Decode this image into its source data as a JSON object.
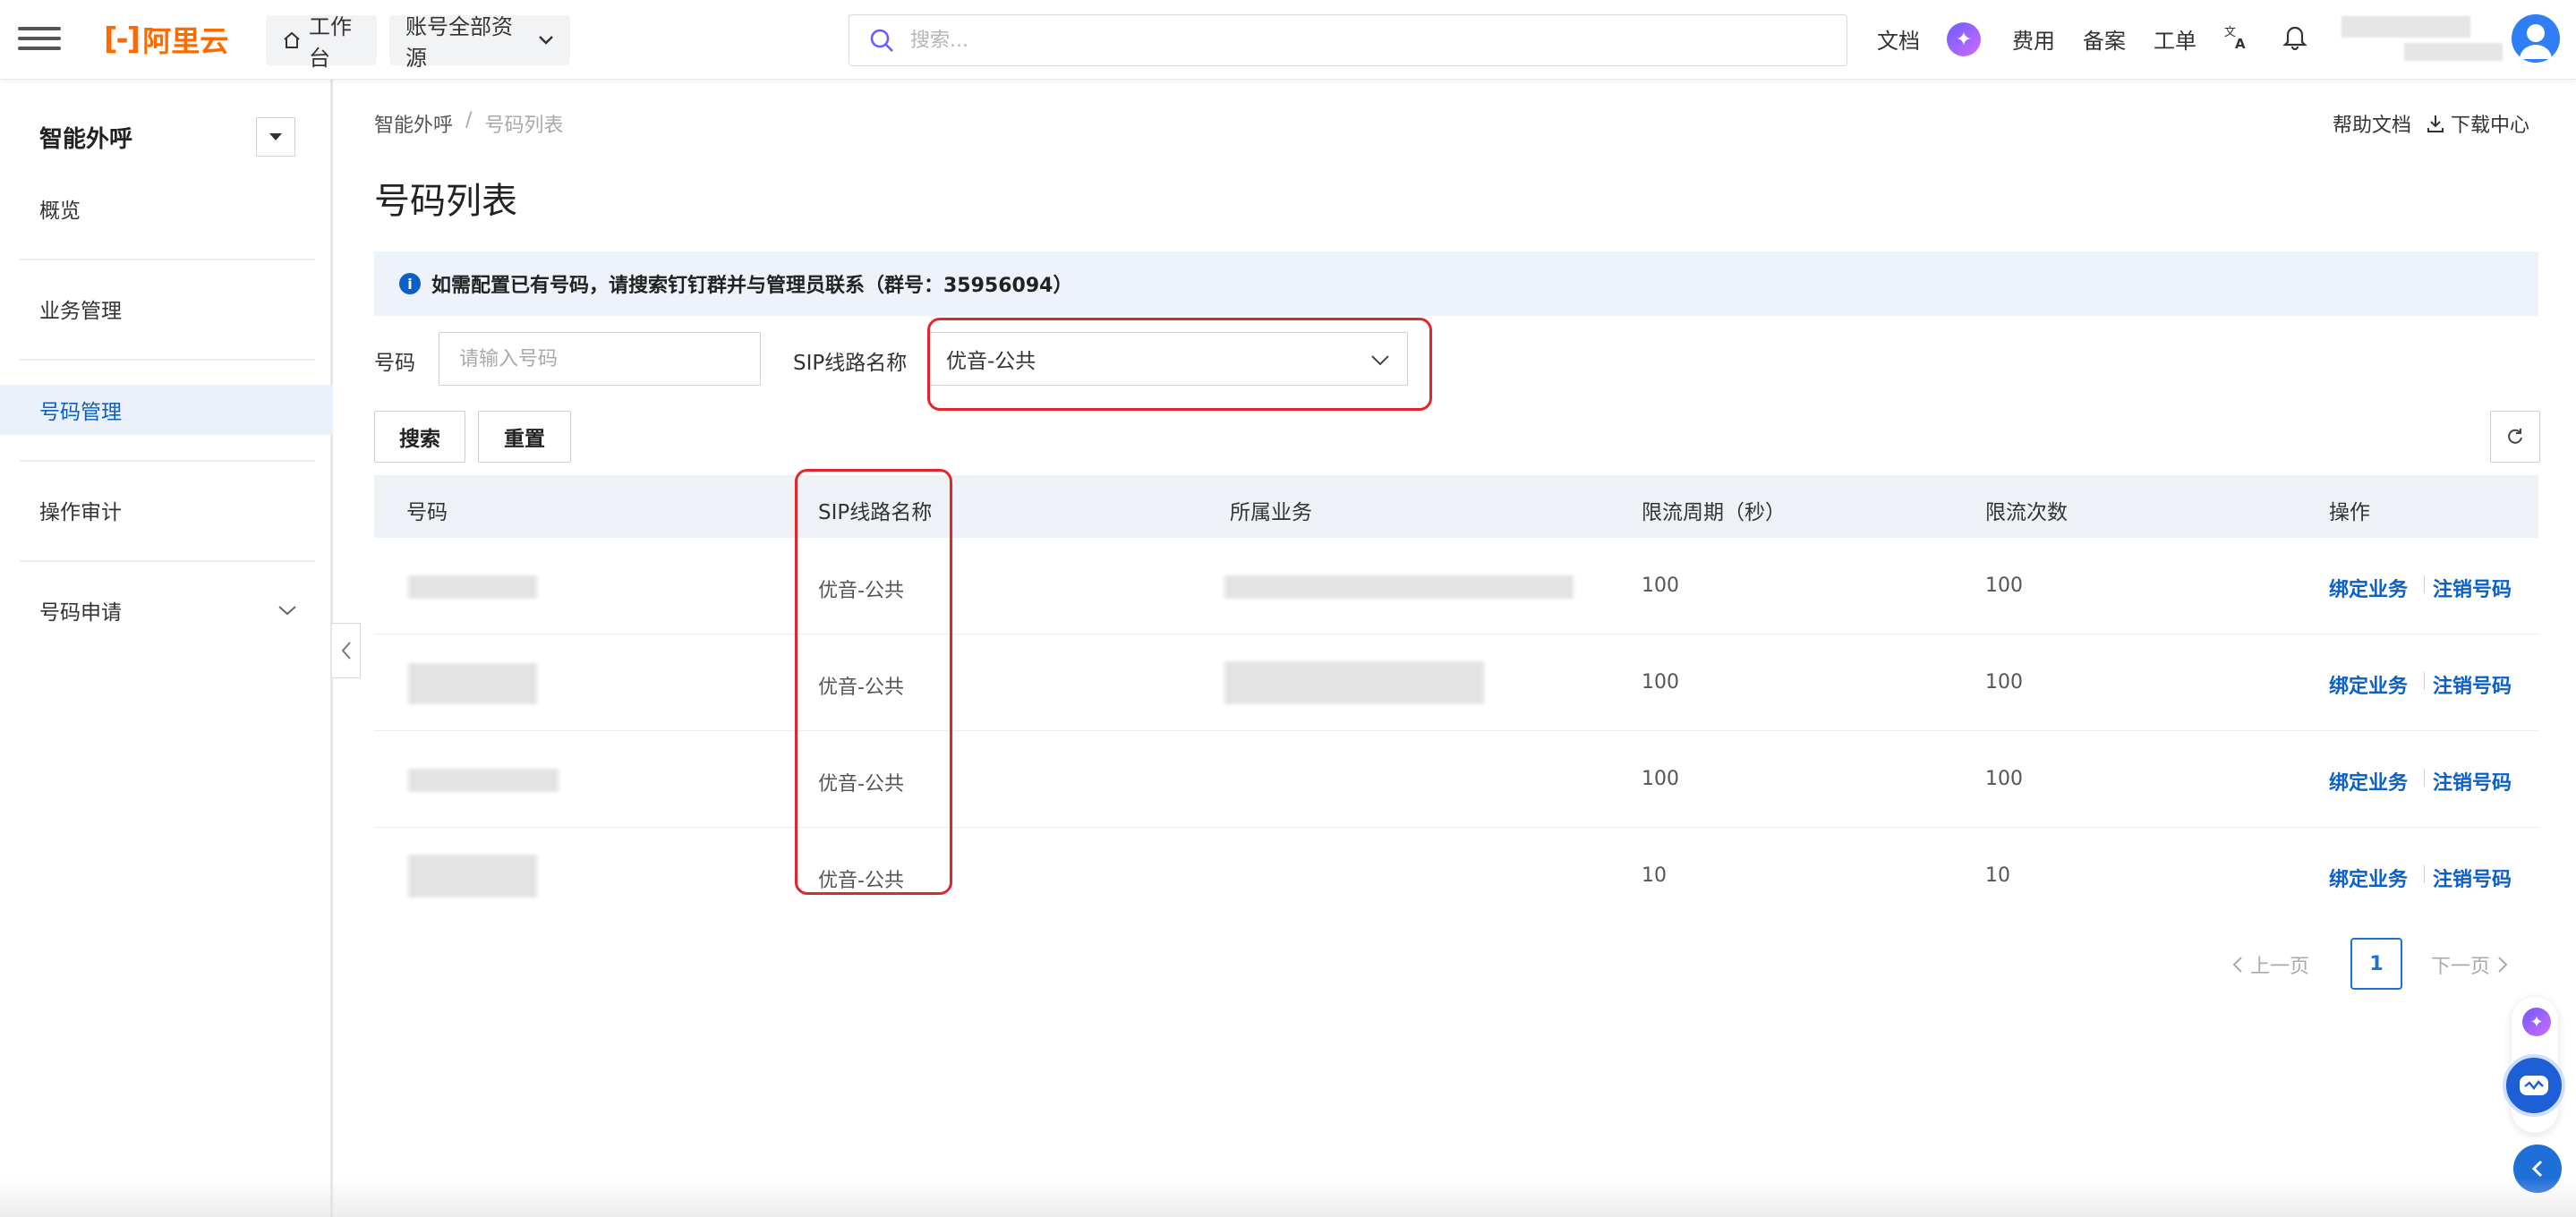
{
  "topbar": {
    "logo_mark": "[-]",
    "logo_text": "阿里云",
    "workbench_label": "工作台",
    "account_scope_label": "账号全部资源",
    "search_placeholder": "搜索...",
    "docs_label": "文档",
    "ai_icon": "sparkle-icon",
    "billing_label": "费用",
    "icp_label": "备案",
    "ticket_label": "工单",
    "language_icon": "translate-icon",
    "notification_icon": "bell-icon",
    "account_name": ""
  },
  "sidebar": {
    "title": "智能外呼",
    "items": [
      {
        "label": "概览"
      },
      {
        "label": "业务管理"
      },
      {
        "label": "号码管理"
      },
      {
        "label": "操作审计"
      },
      {
        "label": "号码申请"
      }
    ],
    "active_index": 2
  },
  "breadcrumb": {
    "root": "智能外呼",
    "separator": "/",
    "current": "号码列表"
  },
  "header_links": {
    "help": "帮助文档",
    "download": "下载中心"
  },
  "page_title": "号码列表",
  "notice": "如需配置已有号码，请搜索钉钉群并与管理员联系（群号：35956094）",
  "filters": {
    "number_label": "号码",
    "number_placeholder": "请输入号码",
    "sip_label": "SIP线路名称",
    "sip_value": "优音-公共"
  },
  "buttons": {
    "search": "搜索",
    "reset": "重置"
  },
  "table": {
    "columns": [
      "号码",
      "SIP线路名称",
      "所属业务",
      "限流周期（秒）",
      "限流次数",
      "操作"
    ],
    "rows": [
      {
        "number": "",
        "sip": "优音-公共",
        "business": "",
        "period": "100",
        "count": "100",
        "op_bind": "绑定业务",
        "op_cancel": "注销号码"
      },
      {
        "number": "",
        "sip": "优音-公共",
        "business": "",
        "period": "100",
        "count": "100",
        "op_bind": "绑定业务",
        "op_cancel": "注销号码"
      },
      {
        "number": "",
        "sip": "优音-公共",
        "business": "",
        "period": "100",
        "count": "100",
        "op_bind": "绑定业务",
        "op_cancel": "注销号码"
      },
      {
        "number": "",
        "sip": "优音-公共",
        "business": "",
        "period": "10",
        "count": "10",
        "op_bind": "绑定业务",
        "op_cancel": "注销号码"
      }
    ]
  },
  "pagination": {
    "prev": "上一页",
    "current": "1",
    "next": "下一页"
  },
  "colors": {
    "accent": "#0b60c8",
    "brand": "#ff6a00",
    "highlight": "#e0272d"
  }
}
